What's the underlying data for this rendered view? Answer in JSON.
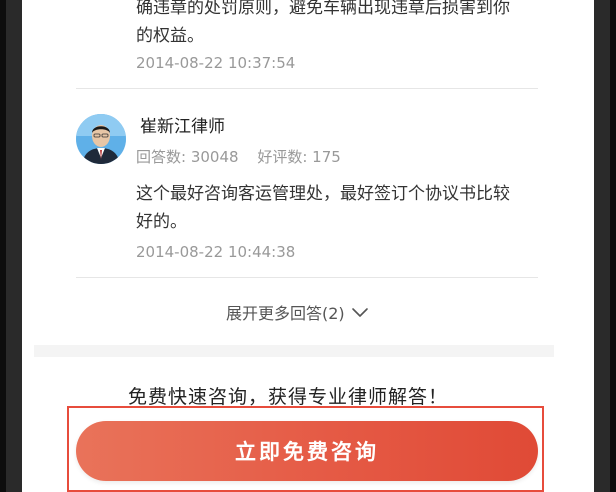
{
  "answers": [
    {
      "text_partial": "确违章的处罚原则，避免车辆出现违章后损害到你的权益。",
      "text_line1": "确违章的处罚原则，避免车辆出现违章后损害到你",
      "text_line2": "的权益。",
      "date": "2014-08-22 10:37:54"
    },
    {
      "lawyer_name": "崔新江律师",
      "answers_label": "回答数: 30048",
      "good_reviews_label": "好评数: 175",
      "text_line1": "这个最好咨询客运管理处，最好签订个协议书比较",
      "text_line2": "好的。",
      "date": "2014-08-22 10:44:38"
    }
  ],
  "expand_more": "展开更多回答(2)",
  "promo_text": "免费快速咨询，获得专业律师解答！",
  "cta_button": "立即免费咨询",
  "colors": {
    "cta_start": "#e9735a",
    "cta_end": "#e04a36",
    "highlight_border": "#e74c3c",
    "date_gray": "#999999"
  },
  "icons": {
    "avatar": "lawyer-avatar",
    "expand": "chevron-down-icon"
  }
}
